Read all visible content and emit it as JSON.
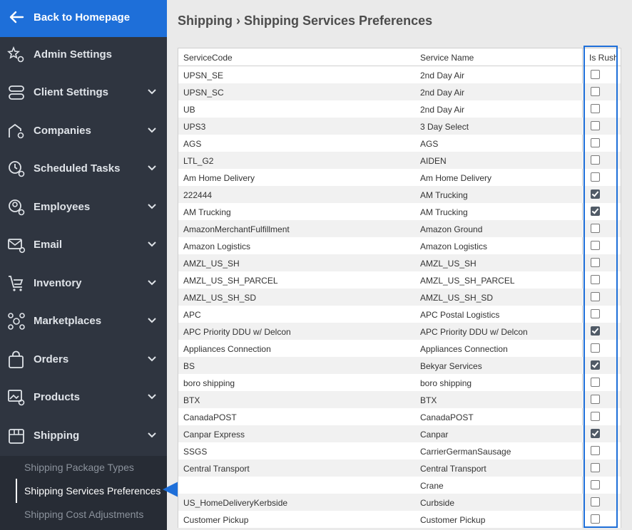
{
  "sidebar": {
    "back_label": "Back to Homepage",
    "items": [
      {
        "label": "Admin Settings",
        "icon": "star-gear-icon"
      },
      {
        "label": "Client Settings",
        "icon": "server-icon"
      },
      {
        "label": "Companies",
        "icon": "building-gear-icon"
      },
      {
        "label": "Scheduled Tasks",
        "icon": "clock-gear-icon"
      },
      {
        "label": "Employees",
        "icon": "person-gear-icon"
      },
      {
        "label": "Email",
        "icon": "envelope-gear-icon"
      },
      {
        "label": "Inventory",
        "icon": "cart-icon"
      },
      {
        "label": "Marketplaces",
        "icon": "network-icon"
      },
      {
        "label": "Orders",
        "icon": "bag-icon"
      },
      {
        "label": "Products",
        "icon": "image-gear-icon"
      },
      {
        "label": "Shipping",
        "icon": "box-icon"
      }
    ],
    "sub_items": [
      "Shipping Package Types",
      "Shipping Services Preferences",
      "Shipping Cost Adjustments"
    ]
  },
  "page": {
    "title": "Shipping › Shipping Services Preferences"
  },
  "table": {
    "headers": [
      "ServiceCode",
      "Service Name",
      "Is Rush"
    ],
    "rows": [
      {
        "code": "UPSN_SE",
        "name": "2nd Day Air",
        "rush": false
      },
      {
        "code": "UPSN_SC",
        "name": "2nd Day Air",
        "rush": false
      },
      {
        "code": "UB",
        "name": "2nd Day Air",
        "rush": false
      },
      {
        "code": "UPS3",
        "name": "3 Day Select",
        "rush": false
      },
      {
        "code": "AGS",
        "name": "AGS",
        "rush": false
      },
      {
        "code": "LTL_G2",
        "name": "AIDEN",
        "rush": false
      },
      {
        "code": "Am Home Delivery",
        "name": "Am Home Delivery",
        "rush": false
      },
      {
        "code": "222444",
        "name": "AM Trucking",
        "rush": true
      },
      {
        "code": "AM Trucking",
        "name": "AM Trucking",
        "rush": true
      },
      {
        "code": "AmazonMerchantFulfillment",
        "name": "Amazon Ground",
        "rush": false
      },
      {
        "code": "Amazon Logistics",
        "name": "Amazon Logistics",
        "rush": false
      },
      {
        "code": "AMZL_US_SH",
        "name": "AMZL_US_SH",
        "rush": false
      },
      {
        "code": "AMZL_US_SH_PARCEL",
        "name": "AMZL_US_SH_PARCEL",
        "rush": false
      },
      {
        "code": "AMZL_US_SH_SD",
        "name": "AMZL_US_SH_SD",
        "rush": false
      },
      {
        "code": "APC",
        "name": "APC Postal Logistics",
        "rush": false
      },
      {
        "code": "APC Priority DDU w/ Delcon",
        "name": "APC Priority DDU w/ Delcon",
        "rush": true
      },
      {
        "code": "Appliances Connection",
        "name": "Appliances Connection",
        "rush": false
      },
      {
        "code": "BS",
        "name": "Bekyar Services",
        "rush": true
      },
      {
        "code": "boro shipping",
        "name": "boro shipping",
        "rush": false
      },
      {
        "code": "BTX",
        "name": "BTX",
        "rush": false
      },
      {
        "code": "CanadaPOST",
        "name": "CanadaPOST",
        "rush": false
      },
      {
        "code": "Canpar Express",
        "name": "Canpar",
        "rush": true
      },
      {
        "code": "SSGS",
        "name": "CarrierGermanSausage",
        "rush": false
      },
      {
        "code": "Central Transport",
        "name": "Central Transport",
        "rush": false
      },
      {
        "code": "",
        "name": "Crane",
        "rush": false
      },
      {
        "code": "US_HomeDeliveryKerbside",
        "name": "Curbside",
        "rush": false
      },
      {
        "code": "Customer Pickup",
        "name": "Customer Pickup",
        "rush": false
      }
    ]
  },
  "colors": {
    "accent": "#1e6fd9",
    "sidebar": "#2f3540",
    "checked": "#505a66"
  }
}
